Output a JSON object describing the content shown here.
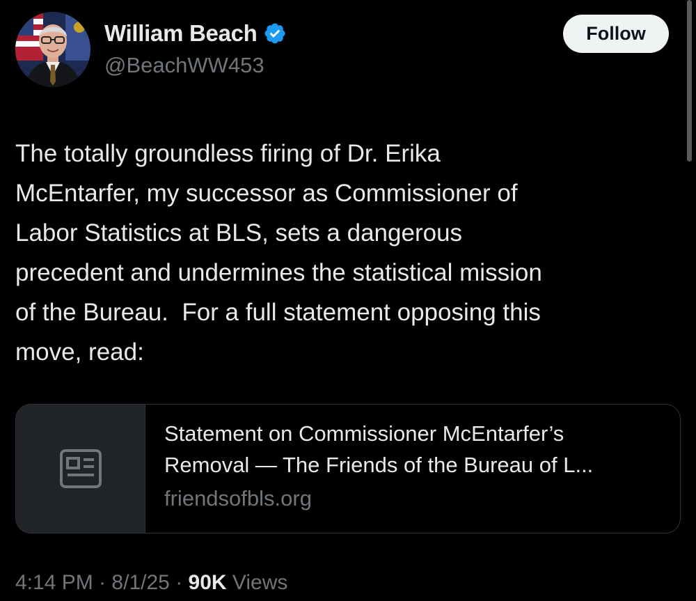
{
  "author": {
    "display_name": "William Beach",
    "handle": "@BeachWW453",
    "verified": true,
    "avatar_icon": "profile-photo"
  },
  "follow_button": {
    "label": "Follow"
  },
  "tweet": {
    "text": "The totally groundless firing of Dr. Erika McEntarfer, my successor as Commissioner of Labor Statistics at BLS, sets a dangerous precedent and undermines the statistical mission of the Bureau.  For a full statement opposing this move, read:",
    "text_lines": [
      "The totally groundless firing of Dr. Erika",
      "McEntarfer, my successor as Commissioner of",
      "Labor Statistics at BLS, sets a dangerous",
      "precedent and undermines the statistical mission",
      "of the Bureau.  For a full statement opposing this",
      "move, read:"
    ]
  },
  "link_card": {
    "thumb_icon": "article-icon",
    "title_line_1": "Statement on Commissioner McEntarfer’s",
    "title_line_2": "Removal — The Friends of the Bureau of L...",
    "domain": "friendsofbls.org"
  },
  "meta": {
    "time": "4:14 PM",
    "separator": "·",
    "date": "8/1/25",
    "views_count": "90K",
    "views_label": "Views"
  },
  "colors": {
    "background": "#000000",
    "text_primary": "#e7e9ea",
    "text_secondary": "#71767b",
    "verified_blue": "#1d9bf0",
    "follow_bg": "#eff3f4",
    "card_border": "#2f3336",
    "card_thumb_bg": "#202327"
  }
}
